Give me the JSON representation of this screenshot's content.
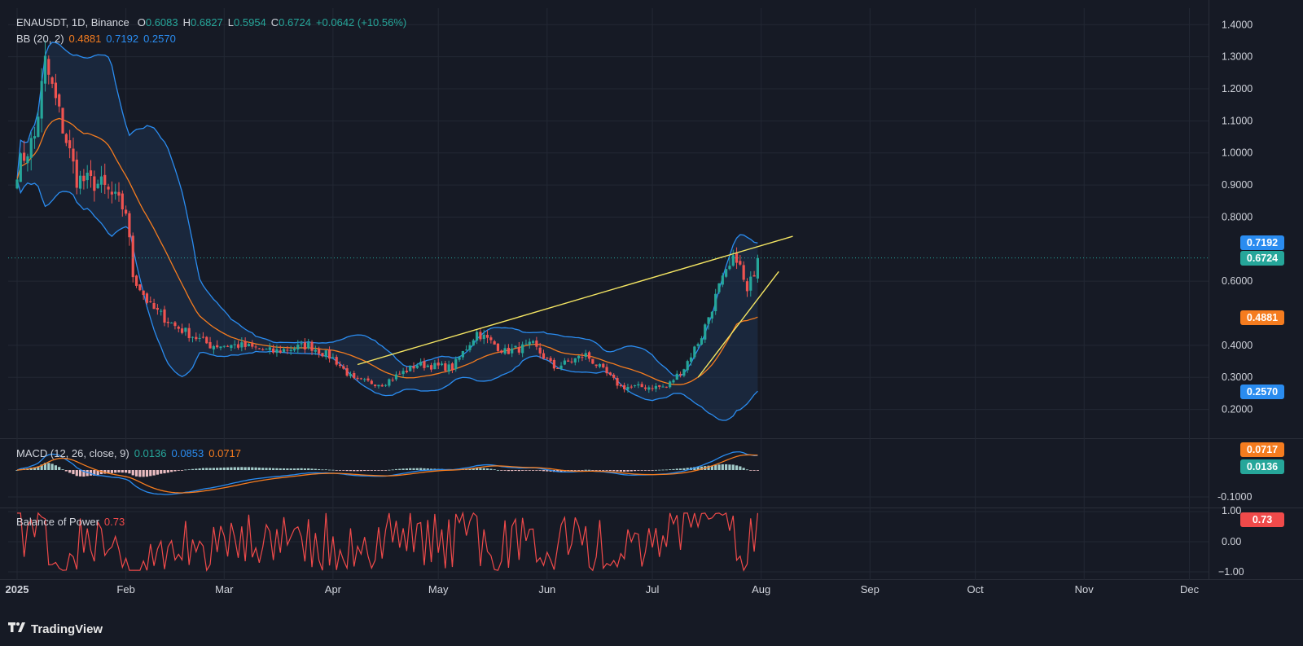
{
  "colors": {
    "background": "#161a25",
    "grid": "#232834",
    "up": "#26a69a",
    "down": "#ef5350",
    "bb_basis": "#f57c1f",
    "bb_band": "#2a8cf0",
    "bb_fill": "#1f3350",
    "trendline": "#f5e663",
    "macd_line": "#2a8cf0",
    "signal_line": "#f57c1f",
    "bop_line": "#f04a4a",
    "axis_text": "#d1d4dc"
  },
  "header": {
    "symbol": "ENAUSDT, 1D, Binance",
    "open_label": "O",
    "open": "0.6083",
    "high_label": "H",
    "high": "0.6827",
    "low_label": "L",
    "low": "0.5954",
    "close_label": "C",
    "close": "0.6724",
    "change": "+0.0642 (+10.56%)"
  },
  "bb_legend": {
    "name": "BB (20, 2)",
    "basis": "0.4881",
    "upper": "0.7192",
    "lower": "0.2570"
  },
  "macd_legend": {
    "name": "MACD (12, 26, close, 9)",
    "hist": "0.0136",
    "macd": "0.0853",
    "signal": "0.0717"
  },
  "bop_legend": {
    "name": "Balance of Power",
    "value": "0.73"
  },
  "price_tags": {
    "upper": "0.7192",
    "close": "0.6724",
    "basis": "0.4881",
    "lower": "0.2570",
    "signal": "0.0717",
    "hist": "0.0136",
    "bop": "0.73"
  },
  "brand": {
    "name": "TradingView"
  },
  "chart_data": [
    {
      "type": "candlestick",
      "title": "ENAUSDT, 1D, Binance",
      "y_scale": "linear",
      "ylim": [
        0.15,
        1.42
      ],
      "y_ticks": [
        "1.4000",
        "1.3000",
        "1.2000",
        "1.1000",
        "1.0000",
        "0.9000",
        "0.8000",
        "0.6000",
        "0.4000",
        "0.3000",
        "0.2000"
      ],
      "x_ticks": [
        "2025",
        "Feb",
        "Mar",
        "Apr",
        "May",
        "Jun",
        "Jul",
        "Aug",
        "Sep",
        "Oct",
        "Nov",
        "Dec"
      ],
      "grid": true,
      "series": [
        {
          "name": "BB (20, 2)",
          "basis_last": 0.4881,
          "upper_last": 0.7192,
          "lower_last": 0.257
        }
      ],
      "approx_close_path": [
        {
          "x": "2025-01-01",
          "y": 0.95
        },
        {
          "x": "2025-01-06",
          "y": 1.05
        },
        {
          "x": "2025-01-09",
          "y": 1.28
        },
        {
          "x": "2025-01-13",
          "y": 1.12
        },
        {
          "x": "2025-01-18",
          "y": 0.92
        },
        {
          "x": "2025-01-25",
          "y": 0.9
        },
        {
          "x": "2025-02-01",
          "y": 0.82
        },
        {
          "x": "2025-02-03",
          "y": 0.62
        },
        {
          "x": "2025-02-08",
          "y": 0.52
        },
        {
          "x": "2025-02-15",
          "y": 0.46
        },
        {
          "x": "2025-02-25",
          "y": 0.4
        },
        {
          "x": "2025-03-05",
          "y": 0.4
        },
        {
          "x": "2025-03-15",
          "y": 0.38
        },
        {
          "x": "2025-03-25",
          "y": 0.4
        },
        {
          "x": "2025-04-01",
          "y": 0.36
        },
        {
          "x": "2025-04-07",
          "y": 0.29
        },
        {
          "x": "2025-04-15",
          "y": 0.28
        },
        {
          "x": "2025-04-25",
          "y": 0.34
        },
        {
          "x": "2025-05-05",
          "y": 0.33
        },
        {
          "x": "2025-05-12",
          "y": 0.44
        },
        {
          "x": "2025-05-20",
          "y": 0.38
        },
        {
          "x": "2025-05-28",
          "y": 0.4
        },
        {
          "x": "2025-06-03",
          "y": 0.33
        },
        {
          "x": "2025-06-12",
          "y": 0.37
        },
        {
          "x": "2025-06-22",
          "y": 0.27
        },
        {
          "x": "2025-06-30",
          "y": 0.27
        },
        {
          "x": "2025-07-05",
          "y": 0.27
        },
        {
          "x": "2025-07-10",
          "y": 0.33
        },
        {
          "x": "2025-07-15",
          "y": 0.43
        },
        {
          "x": "2025-07-20",
          "y": 0.58
        },
        {
          "x": "2025-07-25",
          "y": 0.68
        },
        {
          "x": "2025-07-28",
          "y": 0.56
        },
        {
          "x": "2025-07-31",
          "y": 0.6724
        }
      ],
      "trendlines": [
        {
          "from": {
            "x": "2025-04-08",
            "y": 0.34
          },
          "to": {
            "x": "2025-08-10",
            "y": 0.74
          }
        },
        {
          "from": {
            "x": "2025-07-14",
            "y": 0.3
          },
          "to": {
            "x": "2025-08-06",
            "y": 0.63
          }
        }
      ],
      "last": {
        "open": 0.6083,
        "high": 0.6827,
        "low": 0.5954,
        "close": 0.6724
      }
    },
    {
      "type": "line",
      "title": "MACD (12, 26, close, 9)",
      "y_ticks": [
        "-0.1000"
      ],
      "series": [
        {
          "name": "MACD",
          "last": 0.0853
        },
        {
          "name": "Signal",
          "last": 0.0717
        },
        {
          "name": "Histogram",
          "last": 0.0136
        }
      ]
    },
    {
      "type": "line",
      "title": "Balance of Power",
      "y_ticks": [
        "1.00",
        "0.00",
        "−1.00"
      ],
      "ylim": [
        -1,
        1
      ],
      "series": [
        {
          "name": "Balance of Power",
          "last": 0.73
        }
      ]
    }
  ]
}
